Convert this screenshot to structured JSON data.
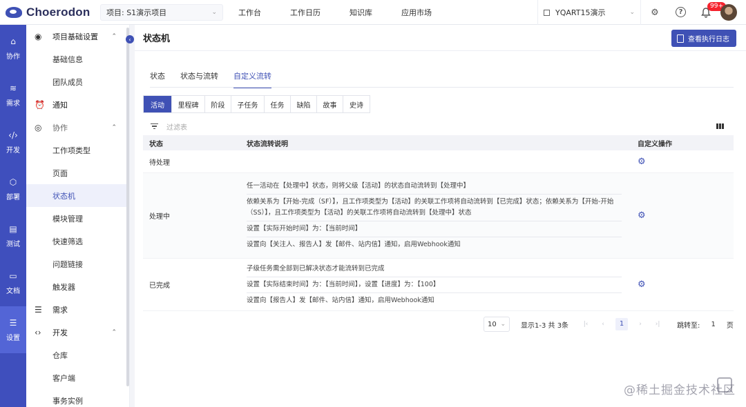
{
  "app": {
    "name": "Choerodon"
  },
  "topbar": {
    "project_selector": "项目: S1演示项目",
    "nav": [
      "工作台",
      "工作日历",
      "知识库",
      "应用市场"
    ],
    "org_selector": "YQART15演示",
    "notification_badge": "99+"
  },
  "rail": [
    {
      "label": "协作",
      "icon": "collab-icon"
    },
    {
      "label": "需求",
      "icon": "layers-icon"
    },
    {
      "label": "开发",
      "icon": "code-icon"
    },
    {
      "label": "部署",
      "icon": "deploy-icon"
    },
    {
      "label": "测试",
      "icon": "clipboard-icon"
    },
    {
      "label": "文档",
      "icon": "inbox-icon"
    },
    {
      "label": "设置",
      "icon": "database-icon",
      "active": true
    }
  ],
  "submenu": {
    "project_settings": "项目基础设置",
    "basic_info": "基础信息",
    "team_members": "团队成员",
    "notify": "通知",
    "collab": "协作",
    "issue_types": "工作项类型",
    "pages": "页面",
    "state_machine": "状态机",
    "modules": "模块管理",
    "quick_filter": "快速筛选",
    "issue_links": "问题链接",
    "triggers": "触发器",
    "requirement": "需求",
    "develop": "开发",
    "repository": "仓库",
    "client": "客户端",
    "service_instance": "事务实例"
  },
  "page": {
    "title": "状态机",
    "log_button": "查看执行日志",
    "tabs": [
      "状态",
      "状态与流转",
      "自定义流转"
    ],
    "issue_type_tabs": [
      "活动",
      "里程碑",
      "阶段",
      "子任务",
      "任务",
      "缺陷",
      "故事",
      "史诗"
    ],
    "filter_placeholder": "过滤表"
  },
  "table": {
    "headers": [
      "状态",
      "状态流转说明",
      "自定义操作"
    ],
    "rows": [
      {
        "state": "待处理",
        "lines": []
      },
      {
        "state": "处理中",
        "lines": [
          "任一活动在【处理中】状态，则将父级【活动】的状态自动流转到【处理中】",
          "依赖关系为【开始-完成（SF）】，且工作项类型为【活动】的关联工作项将自动流转到【已完成】状态；依赖关系为【开始-开始（SS）】，且工作项类型为【活动】的关联工作项将自动流转到【处理中】状态",
          "设置【实际开始时间】为：【当前时间】",
          "设置向【关注人、报告人】发【邮件、站内信】通知，启用Webhook通知"
        ]
      },
      {
        "state": "已完成",
        "lines": [
          "子级任务需全部到已解决状态才能流转到已完成",
          "设置【实际结束时间】为：【当前时间】，设置【进度】为：【100】",
          "设置向【报告人】发【邮件、站内信】通知，启用Webhook通知"
        ]
      }
    ]
  },
  "pagination": {
    "page_size": "10",
    "info": "显示1-3 共 3条",
    "current": "1",
    "jump_label": "跳转至:",
    "jump_value": "1",
    "page_unit": "页"
  },
  "watermark": "@稀土掘金技术社区",
  "colors": {
    "primary": "#3f51b5",
    "rail": "#3f4fbd",
    "rail_active": "#5365d6"
  }
}
